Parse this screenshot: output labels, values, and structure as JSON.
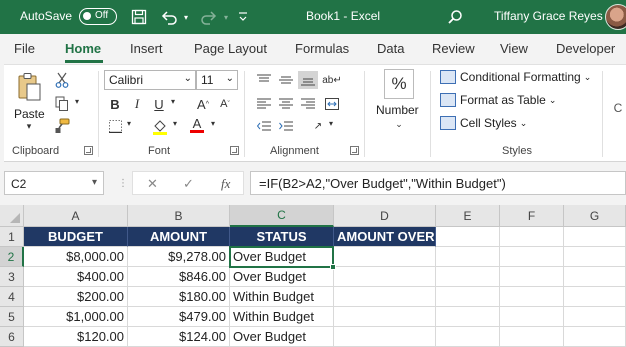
{
  "titlebar": {
    "autosave_label": "AutoSave",
    "autosave_state": "Off",
    "doc_title": "Book1  -  Excel",
    "user_name": "Tiffany Grace Reyes"
  },
  "tabs": [
    "File",
    "Home",
    "Insert",
    "Page Layout",
    "Formulas",
    "Data",
    "Review",
    "View",
    "Developer"
  ],
  "ribbon": {
    "clipboard": {
      "paste_label": "Paste",
      "group_label": "Clipboard"
    },
    "font": {
      "font_name": "Calibri",
      "font_size": "11",
      "group_label": "Font"
    },
    "alignment": {
      "group_label": "Alignment"
    },
    "number": {
      "label": "Number",
      "icon_text": "%"
    },
    "styles": {
      "conditional_formatting": "Conditional Formatting",
      "format_as_table": "Format as Table",
      "cell_styles": "Cell Styles",
      "group_label": "Styles"
    }
  },
  "formula_bar": {
    "name_box": "C2",
    "fx_label": "fx",
    "formula": "=IF(B2>A2,\"Over Budget\",\"Within Budget\")"
  },
  "sheet": {
    "columns": [
      "A",
      "B",
      "C",
      "D",
      "E",
      "F",
      "G"
    ],
    "rows": [
      "1",
      "2",
      "3",
      "4",
      "5",
      "6"
    ],
    "headers": [
      "BUDGET",
      "AMOUNT",
      "STATUS",
      "AMOUNT OVER"
    ],
    "data": [
      [
        "$8,000.00",
        "$9,278.00",
        "Over Budget",
        ""
      ],
      [
        "$400.00",
        "$846.00",
        "Over Budget",
        ""
      ],
      [
        "$200.00",
        "$180.00",
        "Within Budget",
        ""
      ],
      [
        "$1,000.00",
        "$479.00",
        "Within Budget",
        ""
      ],
      [
        "$120.00",
        "$124.00",
        "Over Budget",
        ""
      ]
    ],
    "active_cell": "C2"
  },
  "colors": {
    "brand": "#217346",
    "header_fill": "#203864"
  }
}
